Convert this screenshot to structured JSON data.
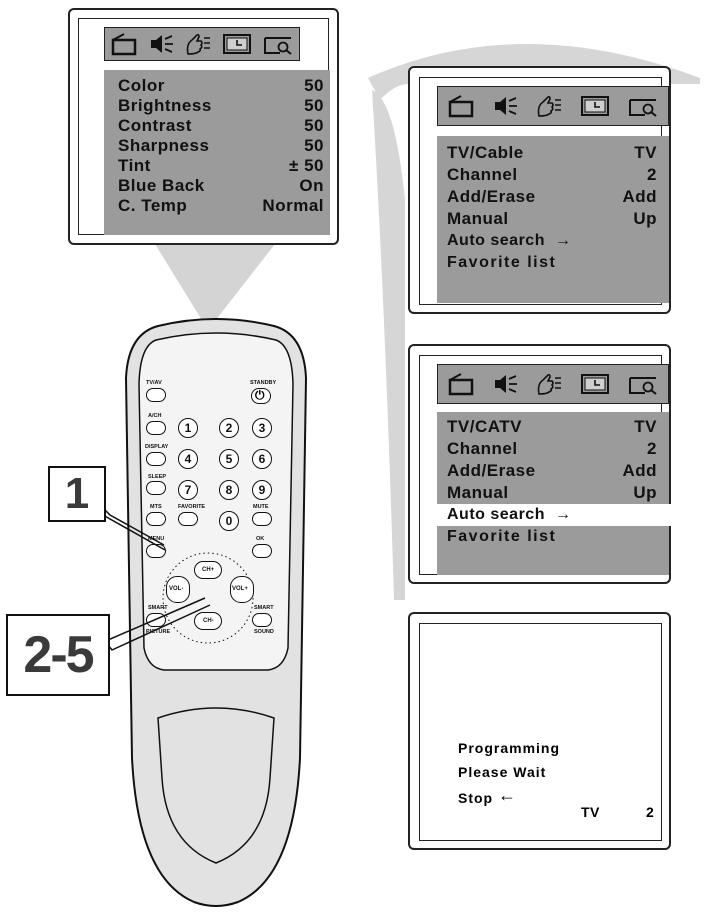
{
  "menu_icons": [
    "tv-icon",
    "speaker-icon",
    "hand-icon",
    "clock-icon",
    "search-icon"
  ],
  "picture_menu": {
    "items": [
      {
        "label": "Color",
        "value": "50"
      },
      {
        "label": "Brightness",
        "value": "50"
      },
      {
        "label": "Contrast",
        "value": "50"
      },
      {
        "label": "Sharpness",
        "value": "50"
      },
      {
        "label": "Tint",
        "value": "± 50"
      },
      {
        "label": "Blue Back",
        "value": "On"
      },
      {
        "label": "C. Temp",
        "value": "Normal"
      }
    ]
  },
  "channel_menu_1": {
    "items": [
      {
        "label": "TV/Cable",
        "value": "TV"
      },
      {
        "label": "Channel",
        "value": "2"
      },
      {
        "label": "Add/Erase",
        "value": "Add"
      },
      {
        "label": "Manual",
        "value": "Up"
      },
      {
        "label": "Auto search",
        "value": "→"
      },
      {
        "label": "Favorite list",
        "value": ""
      }
    ]
  },
  "channel_menu_2": {
    "items": [
      {
        "label": "TV/CATV",
        "value": "TV"
      },
      {
        "label": "Channel",
        "value": "2"
      },
      {
        "label": "Add/Erase",
        "value": "Add"
      },
      {
        "label": "Manual",
        "value": "Up"
      },
      {
        "label": "Auto search",
        "value": "→",
        "highlighted": true
      },
      {
        "label": "Favorite list",
        "value": ""
      }
    ]
  },
  "programming_screen": {
    "line1": "Programming",
    "line2": "Please Wait",
    "stop_label": "Stop",
    "stop_arrow": "←",
    "source": "TV",
    "channel": "2"
  },
  "remote": {
    "labels": {
      "tvav": "TV/AV",
      "standby": "STANDBY",
      "ach": "A/CH",
      "display": "DISPLAY",
      "sleep": "SLEEP",
      "mts": "MTS",
      "favorite": "FAVORITE",
      "mute": "MUTE",
      "menu": "MENU",
      "ok": "OK",
      "smart_left": "SMART",
      "picture": "PICTURE",
      "smart_right": "SMART",
      "sound": "SOUND"
    },
    "digits": [
      "1",
      "2",
      "3",
      "4",
      "5",
      "6",
      "7",
      "8",
      "9",
      "0"
    ],
    "power_symbol": "⏻",
    "nav": {
      "ch_up": "CH+",
      "ch_down": "CH-",
      "vol_down": "VOL-",
      "vol_up": "VOL+"
    }
  },
  "callouts": {
    "step1": "1",
    "step2": "2-5"
  },
  "colors": {
    "menu_grey": "#9b9b9b",
    "beam_grey": "#d6d6d6",
    "remote_body": "#e2e2e2"
  }
}
